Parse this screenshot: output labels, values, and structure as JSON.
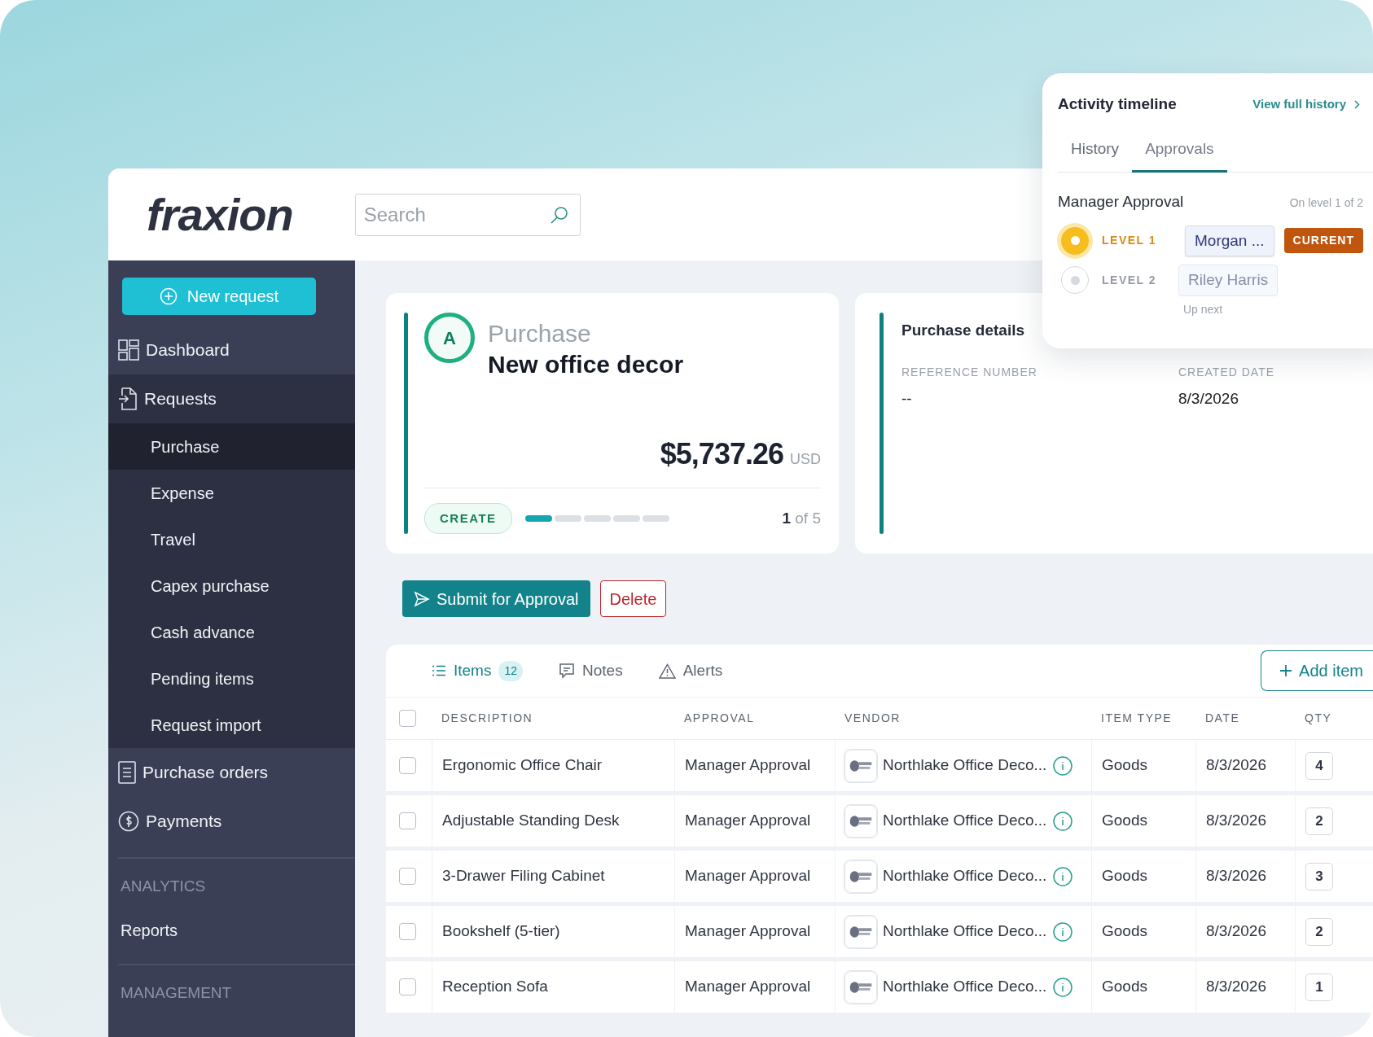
{
  "logo": "fraxion",
  "search": {
    "placeholder": "Search"
  },
  "sidebar": {
    "new_request": "New request",
    "items": [
      {
        "label": "Dashboard",
        "kind": "dashboard",
        "selected": false,
        "expanded": false
      },
      {
        "label": "Requests",
        "kind": "requests",
        "selected": false,
        "expanded": true,
        "children": [
          {
            "label": "Purchase",
            "selected": true
          },
          {
            "label": "Expense",
            "selected": false
          },
          {
            "label": "Travel",
            "selected": false
          },
          {
            "label": "Capex purchase",
            "selected": false
          },
          {
            "label": "Cash advance",
            "selected": false
          },
          {
            "label": "Pending items",
            "selected": false
          },
          {
            "label": "Request import",
            "selected": false
          }
        ]
      },
      {
        "label": "Purchase orders",
        "kind": "orders",
        "selected": false,
        "expanded": false
      },
      {
        "label": "Payments",
        "kind": "payments",
        "selected": false,
        "expanded": false
      }
    ],
    "sections": [
      {
        "title": "ANALYTICS",
        "items": [
          {
            "label": "Reports",
            "selected": false
          }
        ]
      },
      {
        "title": "MANAGEMENT"
      }
    ]
  },
  "request": {
    "avatar": "A",
    "type": "Purchase",
    "title": "New office decor",
    "amount": "$5,737.26",
    "currency": "USD",
    "stage": "CREATE",
    "steps": [
      {
        "done": true
      },
      {
        "done": false
      },
      {
        "done": false
      },
      {
        "done": false
      },
      {
        "done": false
      }
    ],
    "step_counter": "**1** of 5"
  },
  "details": {
    "title": "Purchase details",
    "fields": [
      {
        "label": "REFERENCE NUMBER",
        "value": "--"
      },
      {
        "label": "CREATED DATE",
        "value": "8/3/2026"
      }
    ]
  },
  "actions": {
    "submit": "Submit for Approval",
    "delete": "Delete"
  },
  "items_tabs": [
    {
      "label": "Items",
      "kind": "list",
      "count": "12",
      "selected": true
    },
    {
      "label": "Notes",
      "kind": "notes",
      "selected": false
    },
    {
      "label": "Alerts",
      "kind": "alerts",
      "selected": false
    }
  ],
  "add_item": "Add item",
  "table": {
    "select_all": {
      "checked": false
    },
    "columns": [
      "DESCRIPTION",
      "APPROVAL",
      "VENDOR",
      "ITEM TYPE",
      "DATE",
      "QTY"
    ],
    "rows": [
      {
        "checked": false,
        "description": "Ergonomic Office Chair",
        "approval": "Manager Approval",
        "vendor": "Northlake Office Deco...",
        "item_type": "Goods",
        "date": "8/3/2026",
        "qty": "4"
      },
      {
        "checked": false,
        "description": "Adjustable Standing Desk",
        "approval": "Manager Approval",
        "vendor": "Northlake Office Deco...",
        "item_type": "Goods",
        "date": "8/3/2026",
        "qty": "2"
      },
      {
        "checked": false,
        "description": "3-Drawer Filing Cabinet",
        "approval": "Manager Approval",
        "vendor": "Northlake Office Deco...",
        "item_type": "Goods",
        "date": "8/3/2026",
        "qty": "3"
      },
      {
        "checked": false,
        "description": "Bookshelf (5-tier)",
        "approval": "Manager Approval",
        "vendor": "Northlake Office Deco...",
        "item_type": "Goods",
        "date": "8/3/2026",
        "qty": "2"
      },
      {
        "checked": false,
        "description": "Reception Sofa",
        "approval": "Manager Approval",
        "vendor": "Northlake Office Deco...",
        "item_type": "Goods",
        "date": "8/3/2026",
        "qty": "1"
      }
    ]
  },
  "timeline": {
    "title": "Activity timeline",
    "link": "View full history",
    "tabs": [
      {
        "label": "History",
        "selected": false
      },
      {
        "label": "Approvals",
        "selected": true
      }
    ],
    "section": "Manager Approval",
    "progress": "On level 1 of 2",
    "levels": [
      {
        "label": "LEVEL 1",
        "approver": "Morgan ...",
        "current": true,
        "badge": "CURRENT"
      },
      {
        "label": "LEVEL 2",
        "approver": "Riley Harris",
        "current": false,
        "note": "Up next"
      }
    ]
  }
}
